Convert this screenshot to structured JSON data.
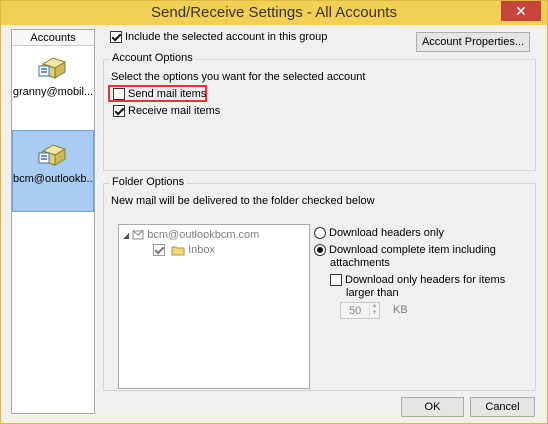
{
  "window": {
    "title": "Send/Receive Settings - All Accounts",
    "close_label": "✕"
  },
  "accounts": {
    "header": "Accounts",
    "items": [
      {
        "label": "granny@mobil...",
        "selected": false
      },
      {
        "label": "bcm@outlookb...",
        "selected": true
      }
    ]
  },
  "top": {
    "include_label": "Include the selected account in this group",
    "include_checked": true,
    "account_properties_label": "Account Properties..."
  },
  "account_options": {
    "title": "Account Options",
    "instruction": "Select the options you want for the selected account",
    "send_mail_label": "Send mail items",
    "send_mail_checked": false,
    "receive_mail_label": "Receive mail items",
    "receive_mail_checked": true
  },
  "folder_options": {
    "title": "Folder Options",
    "instruction": "New mail will be delivered to the folder checked below",
    "tree": {
      "account": "bcm@outlookbcm.com",
      "folder": "Inbox",
      "folder_checked": true
    },
    "download_headers_label": "Download headers only",
    "download_complete_label_1": "Download complete item including",
    "download_complete_label_2": "attachments",
    "download_only_headers_label_1": "Download only headers for items",
    "download_only_headers_label_2": "larger than",
    "size_value": "50",
    "size_unit": "KB"
  },
  "footer": {
    "ok_label": "OK",
    "cancel_label": "Cancel"
  }
}
